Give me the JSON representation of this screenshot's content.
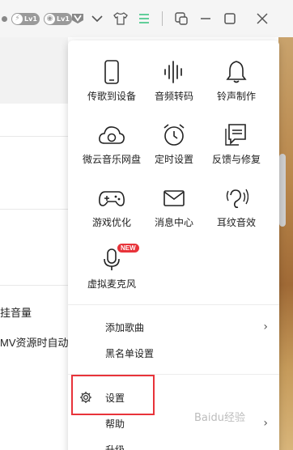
{
  "titlebar": {
    "badge1": "Lv1",
    "badge2": "Lv1"
  },
  "background": {
    "row1": "挂音量",
    "row2": "MV资源时自动播"
  },
  "menu": {
    "grid": [
      {
        "label": "传歌到设备",
        "icon": "phone-icon"
      },
      {
        "label": "音频转码",
        "icon": "audio-wave-icon"
      },
      {
        "label": "铃声制作",
        "icon": "bell-icon"
      },
      {
        "label": "微云音乐网盘",
        "icon": "cloud-icon"
      },
      {
        "label": "定时设置",
        "icon": "alarm-clock-icon"
      },
      {
        "label": "反馈与修复",
        "icon": "feedback-icon"
      },
      {
        "label": "游戏优化",
        "icon": "gamepad-icon"
      },
      {
        "label": "消息中心",
        "icon": "envelope-icon"
      },
      {
        "label": "耳纹音效",
        "icon": "ear-icon"
      },
      {
        "label": "虚拟麦克风",
        "icon": "microphone-icon",
        "badge": "NEW"
      }
    ],
    "list": [
      {
        "label": "添加歌曲",
        "chevron": "›"
      },
      {
        "label": "黑名单设置"
      },
      {
        "label": "设置",
        "icon": "gear-icon"
      },
      {
        "label": "帮助",
        "chevron": "›"
      },
      {
        "label": "升级"
      }
    ]
  },
  "watermark": "Baidu经验",
  "colors": {
    "accent": "#31c27c",
    "highlight": "#e8333a"
  }
}
